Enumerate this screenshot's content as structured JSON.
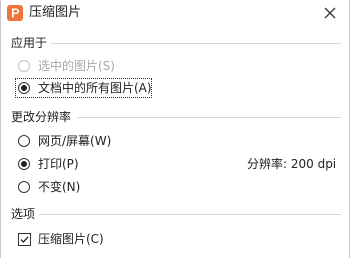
{
  "window": {
    "title": "压缩图片",
    "app_icon": "wps-presentation-icon",
    "close_icon": "close-icon"
  },
  "apply_to": {
    "header": "应用于",
    "options": [
      {
        "label": "选中的图片(S)",
        "selected": false,
        "enabled": false
      },
      {
        "label": "文档中的所有图片(A)",
        "selected": true,
        "enabled": true
      }
    ]
  },
  "resolution": {
    "header": "更改分辨率",
    "options": [
      {
        "label": "网页/屏幕(W)",
        "selected": false
      },
      {
        "label": "打印(P)",
        "selected": true
      },
      {
        "label": "不变(N)",
        "selected": false
      }
    ],
    "readout": "分辨率: 200 dpi"
  },
  "options": {
    "header": "选项",
    "items": [
      {
        "label": "压缩图片(C)",
        "checked": true
      }
    ]
  },
  "colors": {
    "accent": "#f0753a",
    "rule": "#d6d6d6",
    "disabled_text": "#a8a8a8"
  }
}
